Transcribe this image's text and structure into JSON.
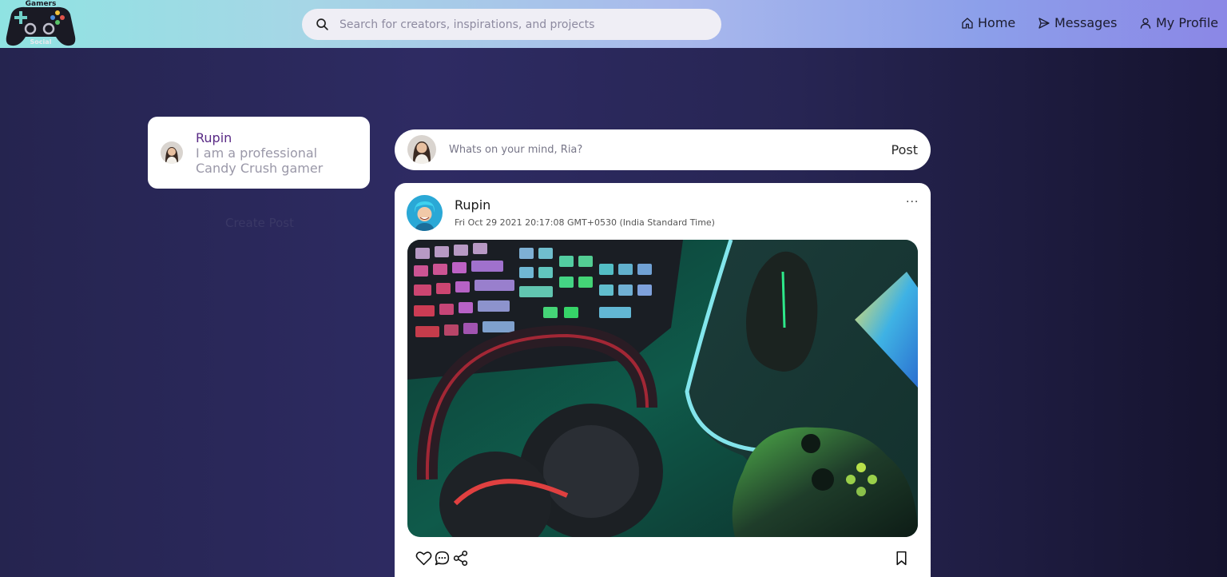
{
  "header": {
    "logo": {
      "top_text": "Gamers",
      "bottom_text": "Social"
    },
    "search_placeholder": "Search for creators, inspirations, and projects",
    "nav": {
      "home": "Home",
      "messages": "Messages",
      "profile": "My Profile"
    }
  },
  "sidebar": {
    "profile": {
      "name": "Rupin",
      "bio": "I am a professional Candy Crush gamer"
    },
    "create_post": "Create Post"
  },
  "composer": {
    "placeholder": "Whats on your mind, Ria?",
    "post_label": "Post"
  },
  "feed": {
    "posts": [
      {
        "author": "Rupin",
        "timestamp": "Fri Oct 29 2021 20:17:08 GMT+0530 (India Standard Time)",
        "more_label": "···"
      }
    ]
  },
  "colors": {
    "accent": "#5a2b86",
    "header_start": "#8fe3e2",
    "header_end": "#8b87e6",
    "background": "#2e2b63"
  }
}
